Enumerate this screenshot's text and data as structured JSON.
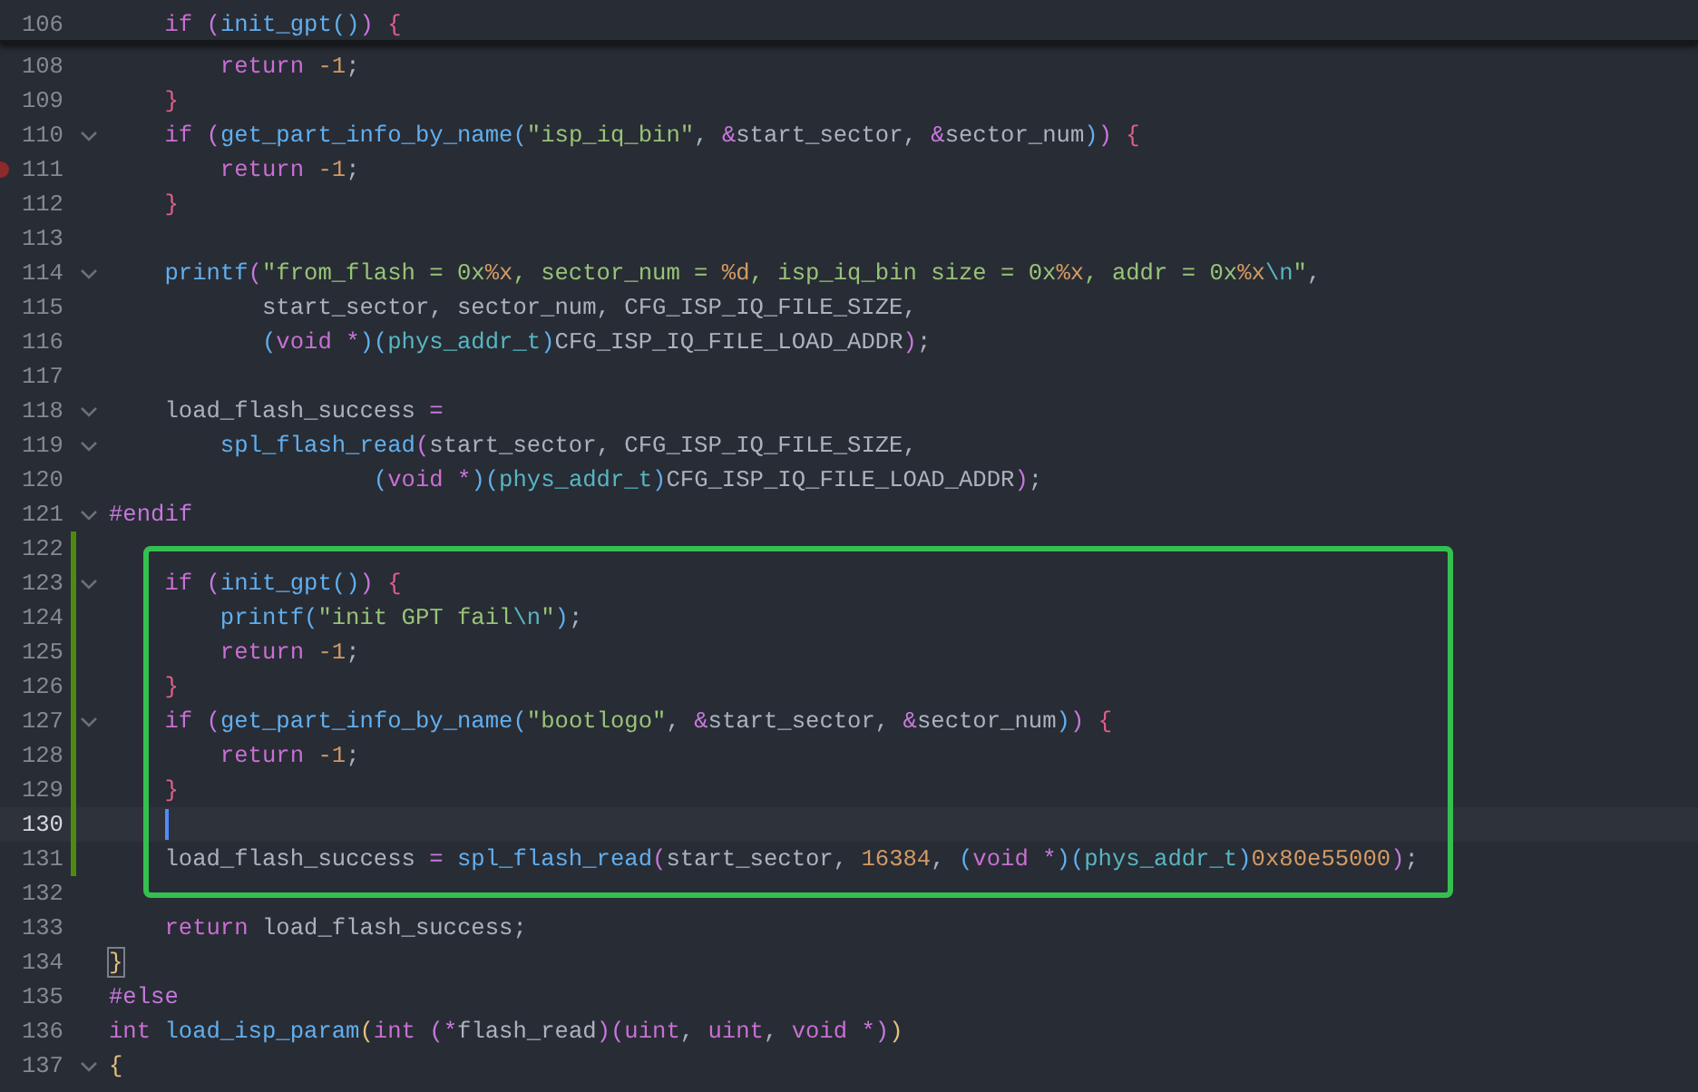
{
  "sticky_line": {
    "number": "106",
    "fold": false,
    "code": [
      {
        "kind": "keyword",
        "text": "    if "
      },
      {
        "kind": "paren-purple",
        "text": "("
      },
      {
        "kind": "function",
        "text": "init_gpt"
      },
      {
        "kind": "paren-blue",
        "text": "()"
      },
      {
        "kind": "paren-purple",
        "text": ") "
      },
      {
        "kind": "brace",
        "text": "{"
      }
    ]
  },
  "lines": [
    {
      "number": "108",
      "fold": false,
      "breakpoint": false,
      "modified": false,
      "current": false,
      "boxed": false,
      "code": [
        {
          "kind": "keyword",
          "text": "        return "
        },
        {
          "kind": "number",
          "text": "-1"
        },
        {
          "kind": "plain",
          "text": ";"
        }
      ]
    },
    {
      "number": "109",
      "fold": false,
      "breakpoint": false,
      "modified": false,
      "current": false,
      "boxed": false,
      "code": [
        {
          "kind": "brace",
          "text": "    }"
        }
      ]
    },
    {
      "number": "110",
      "fold": true,
      "breakpoint": false,
      "modified": false,
      "current": false,
      "boxed": false,
      "code": [
        {
          "kind": "keyword",
          "text": "    if "
        },
        {
          "kind": "paren-purple",
          "text": "("
        },
        {
          "kind": "function",
          "text": "get_part_info_by_name"
        },
        {
          "kind": "paren-blue",
          "text": "("
        },
        {
          "kind": "string",
          "text": "\"isp_iq_bin\""
        },
        {
          "kind": "plain",
          "text": ", "
        },
        {
          "kind": "operator",
          "text": "&"
        },
        {
          "kind": "plain",
          "text": "start_sector, "
        },
        {
          "kind": "operator",
          "text": "&"
        },
        {
          "kind": "plain",
          "text": "sector_num"
        },
        {
          "kind": "paren-blue",
          "text": ")"
        },
        {
          "kind": "paren-purple",
          "text": ") "
        },
        {
          "kind": "brace",
          "text": "{"
        }
      ]
    },
    {
      "number": "111",
      "fold": false,
      "breakpoint": true,
      "modified": false,
      "current": false,
      "boxed": false,
      "code": [
        {
          "kind": "keyword",
          "text": "        return "
        },
        {
          "kind": "number",
          "text": "-1"
        },
        {
          "kind": "plain",
          "text": ";"
        }
      ]
    },
    {
      "number": "112",
      "fold": false,
      "breakpoint": false,
      "modified": false,
      "current": false,
      "boxed": false,
      "code": [
        {
          "kind": "brace",
          "text": "    }"
        }
      ]
    },
    {
      "number": "113",
      "fold": false,
      "breakpoint": false,
      "modified": false,
      "current": false,
      "boxed": false
    },
    {
      "number": "114",
      "fold": true,
      "breakpoint": false,
      "modified": false,
      "current": false,
      "boxed": false,
      "code": [
        {
          "kind": "function",
          "text": "    printf"
        },
        {
          "kind": "paren-purple",
          "text": "("
        },
        {
          "kind": "string",
          "text": "\"from_flash = 0x"
        },
        {
          "kind": "number",
          "text": "%x"
        },
        {
          "kind": "string",
          "text": ", sector_num = "
        },
        {
          "kind": "number",
          "text": "%d"
        },
        {
          "kind": "string",
          "text": ", isp_iq_bin size = 0x"
        },
        {
          "kind": "number",
          "text": "%x"
        },
        {
          "kind": "string",
          "text": ", addr = 0x"
        },
        {
          "kind": "number",
          "text": "%x"
        },
        {
          "kind": "escape",
          "text": "\\n"
        },
        {
          "kind": "string",
          "text": "\""
        },
        {
          "kind": "plain",
          "text": ","
        }
      ]
    },
    {
      "number": "115",
      "fold": false,
      "breakpoint": false,
      "modified": false,
      "current": false,
      "boxed": false,
      "code": [
        {
          "kind": "plain",
          "text": "           start_sector, sector_num, CFG_ISP_IQ_FILE_SIZE,"
        }
      ]
    },
    {
      "number": "116",
      "fold": false,
      "breakpoint": false,
      "modified": false,
      "current": false,
      "boxed": false,
      "code": [
        {
          "kind": "paren-blue",
          "text": "           ("
        },
        {
          "kind": "keyword",
          "text": "void "
        },
        {
          "kind": "operator",
          "text": "*"
        },
        {
          "kind": "paren-blue",
          "text": ")("
        },
        {
          "kind": "type",
          "text": "phys_addr_t"
        },
        {
          "kind": "paren-blue",
          "text": ")"
        },
        {
          "kind": "plain",
          "text": "CFG_ISP_IQ_FILE_LOAD_ADDR"
        },
        {
          "kind": "paren-purple",
          "text": ")"
        },
        {
          "kind": "plain",
          "text": ";"
        }
      ]
    },
    {
      "number": "117",
      "fold": false,
      "breakpoint": false,
      "modified": false,
      "current": false,
      "boxed": false
    },
    {
      "number": "118",
      "fold": true,
      "breakpoint": false,
      "modified": false,
      "current": false,
      "boxed": false,
      "code": [
        {
          "kind": "plain",
          "text": "    load_flash_success "
        },
        {
          "kind": "operator",
          "text": "="
        }
      ]
    },
    {
      "number": "119",
      "fold": true,
      "breakpoint": false,
      "modified": false,
      "current": false,
      "boxed": false,
      "code": [
        {
          "kind": "function",
          "text": "        spl_flash_read"
        },
        {
          "kind": "paren-purple",
          "text": "("
        },
        {
          "kind": "plain",
          "text": "start_sector, CFG_ISP_IQ_FILE_SIZE,"
        }
      ]
    },
    {
      "number": "120",
      "fold": false,
      "breakpoint": false,
      "modified": false,
      "current": false,
      "boxed": false,
      "code": [
        {
          "kind": "paren-blue",
          "text": "                   ("
        },
        {
          "kind": "keyword",
          "text": "void "
        },
        {
          "kind": "operator",
          "text": "*"
        },
        {
          "kind": "paren-blue",
          "text": ")("
        },
        {
          "kind": "type",
          "text": "phys_addr_t"
        },
        {
          "kind": "paren-blue",
          "text": ")"
        },
        {
          "kind": "plain",
          "text": "CFG_ISP_IQ_FILE_LOAD_ADDR"
        },
        {
          "kind": "paren-purple",
          "text": ")"
        },
        {
          "kind": "plain",
          "text": ";"
        }
      ]
    },
    {
      "number": "121",
      "fold": true,
      "breakpoint": false,
      "modified": false,
      "current": false,
      "boxed": false,
      "code": [
        {
          "kind": "macro",
          "text": "#endif"
        }
      ]
    },
    {
      "number": "122",
      "fold": false,
      "breakpoint": false,
      "modified": true,
      "current": false,
      "boxed": false
    },
    {
      "number": "123",
      "fold": true,
      "breakpoint": false,
      "modified": true,
      "current": false,
      "boxed": true,
      "code": [
        {
          "kind": "keyword",
          "text": "    if "
        },
        {
          "kind": "paren-purple",
          "text": "("
        },
        {
          "kind": "function",
          "text": "init_gpt"
        },
        {
          "kind": "paren-blue",
          "text": "()"
        },
        {
          "kind": "paren-purple",
          "text": ") "
        },
        {
          "kind": "brace",
          "text": "{"
        }
      ]
    },
    {
      "number": "124",
      "fold": false,
      "breakpoint": false,
      "modified": true,
      "current": false,
      "boxed": true,
      "code": [
        {
          "kind": "function",
          "text": "        printf"
        },
        {
          "kind": "paren-blue",
          "text": "("
        },
        {
          "kind": "string",
          "text": "\"init GPT fail"
        },
        {
          "kind": "escape",
          "text": "\\n"
        },
        {
          "kind": "string",
          "text": "\""
        },
        {
          "kind": "paren-blue",
          "text": ")"
        },
        {
          "kind": "plain",
          "text": ";"
        }
      ]
    },
    {
      "number": "125",
      "fold": false,
      "breakpoint": false,
      "modified": true,
      "current": false,
      "boxed": true,
      "code": [
        {
          "kind": "keyword",
          "text": "        return "
        },
        {
          "kind": "number",
          "text": "-1"
        },
        {
          "kind": "plain",
          "text": ";"
        }
      ]
    },
    {
      "number": "126",
      "fold": false,
      "breakpoint": false,
      "modified": true,
      "current": false,
      "boxed": true,
      "code": [
        {
          "kind": "brace",
          "text": "    }"
        }
      ]
    },
    {
      "number": "127",
      "fold": true,
      "breakpoint": false,
      "modified": true,
      "current": false,
      "boxed": true,
      "code": [
        {
          "kind": "keyword",
          "text": "    if "
        },
        {
          "kind": "paren-purple",
          "text": "("
        },
        {
          "kind": "function",
          "text": "get_part_info_by_name"
        },
        {
          "kind": "paren-blue",
          "text": "("
        },
        {
          "kind": "string",
          "text": "\"bootlogo\""
        },
        {
          "kind": "plain",
          "text": ", "
        },
        {
          "kind": "operator",
          "text": "&"
        },
        {
          "kind": "plain",
          "text": "start_sector, "
        },
        {
          "kind": "operator",
          "text": "&"
        },
        {
          "kind": "plain",
          "text": "sector_num"
        },
        {
          "kind": "paren-blue",
          "text": ")"
        },
        {
          "kind": "paren-purple",
          "text": ") "
        },
        {
          "kind": "brace",
          "text": "{"
        }
      ]
    },
    {
      "number": "128",
      "fold": false,
      "breakpoint": false,
      "modified": true,
      "current": false,
      "boxed": true,
      "code": [
        {
          "kind": "keyword",
          "text": "        return "
        },
        {
          "kind": "number",
          "text": "-1"
        },
        {
          "kind": "plain",
          "text": ";"
        }
      ]
    },
    {
      "number": "129",
      "fold": false,
      "breakpoint": false,
      "modified": true,
      "current": false,
      "boxed": true,
      "code": [
        {
          "kind": "brace",
          "text": "    }"
        }
      ]
    },
    {
      "number": "130",
      "fold": false,
      "breakpoint": false,
      "modified": true,
      "current": true,
      "boxed": true
    },
    {
      "number": "131",
      "fold": false,
      "breakpoint": false,
      "modified": true,
      "current": false,
      "boxed": true,
      "code": [
        {
          "kind": "plain",
          "text": "    load_flash_success "
        },
        {
          "kind": "operator",
          "text": "= "
        },
        {
          "kind": "function",
          "text": "spl_flash_read"
        },
        {
          "kind": "paren-purple",
          "text": "("
        },
        {
          "kind": "plain",
          "text": "start_sector, "
        },
        {
          "kind": "number",
          "text": "16384"
        },
        {
          "kind": "plain",
          "text": ", "
        },
        {
          "kind": "paren-blue",
          "text": "("
        },
        {
          "kind": "keyword",
          "text": "void "
        },
        {
          "kind": "operator",
          "text": "*"
        },
        {
          "kind": "paren-blue",
          "text": ")("
        },
        {
          "kind": "type",
          "text": "phys_addr_t"
        },
        {
          "kind": "paren-blue",
          "text": ")"
        },
        {
          "kind": "number",
          "text": "0x80e55000"
        },
        {
          "kind": "paren-purple",
          "text": ")"
        },
        {
          "kind": "plain",
          "text": ";"
        }
      ]
    },
    {
      "number": "132",
      "fold": false,
      "breakpoint": false,
      "modified": false,
      "current": false,
      "boxed": false
    },
    {
      "number": "133",
      "fold": false,
      "breakpoint": false,
      "modified": false,
      "current": false,
      "boxed": false,
      "code": [
        {
          "kind": "keyword",
          "text": "    return"
        },
        {
          "kind": "plain",
          "text": " load_flash_success;"
        }
      ]
    },
    {
      "number": "134",
      "fold": false,
      "breakpoint": false,
      "modified": false,
      "current": false,
      "boxed": false,
      "code": [
        {
          "kind": "brace-match",
          "text": "}"
        }
      ]
    },
    {
      "number": "135",
      "fold": false,
      "breakpoint": false,
      "modified": false,
      "current": false,
      "boxed": false,
      "code": [
        {
          "kind": "macro",
          "text": "#else"
        }
      ]
    },
    {
      "number": "136",
      "fold": false,
      "breakpoint": false,
      "modified": false,
      "current": false,
      "boxed": false,
      "code": [
        {
          "kind": "keyword",
          "text": "int "
        },
        {
          "kind": "function",
          "text": "load_isp_param"
        },
        {
          "kind": "paren-yellow",
          "text": "("
        },
        {
          "kind": "keyword",
          "text": "int "
        },
        {
          "kind": "paren-purple",
          "text": "("
        },
        {
          "kind": "operator",
          "text": "*"
        },
        {
          "kind": "plain",
          "text": "flash_read"
        },
        {
          "kind": "paren-purple",
          "text": ")("
        },
        {
          "kind": "keyword",
          "text": "uint"
        },
        {
          "kind": "plain",
          "text": ", "
        },
        {
          "kind": "keyword",
          "text": "uint"
        },
        {
          "kind": "plain",
          "text": ", "
        },
        {
          "kind": "keyword",
          "text": "void "
        },
        {
          "kind": "operator",
          "text": "*"
        },
        {
          "kind": "paren-purple",
          "text": ")"
        },
        {
          "kind": "paren-yellow",
          "text": ")"
        }
      ]
    },
    {
      "number": "137",
      "fold": true,
      "breakpoint": false,
      "modified": false,
      "current": false,
      "boxed": false,
      "code": [
        {
          "kind": "paren-yellow",
          "text": "{"
        }
      ]
    }
  ]
}
